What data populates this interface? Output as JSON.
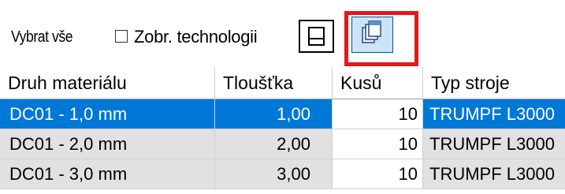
{
  "toolbar": {
    "select_all_label": "Vybrat vše",
    "show_technologies_label": "Zobr. technologii",
    "show_technologies_checked": false,
    "highlight_color": "#e0191c",
    "buttons": [
      {
        "icon": "single-page-icon"
      },
      {
        "icon": "copy-pages-icon",
        "active": true
      }
    ]
  },
  "table": {
    "columns": [
      "Druh materiálu",
      "Tloušťka",
      "Kusů",
      "Typ stroje"
    ],
    "rows": [
      {
        "material": "DC01 - 1,0 mm",
        "thickness": "1,00",
        "pieces": "10",
        "machine": "TRUMPF L3000",
        "selected": true
      },
      {
        "material": "DC01 - 2,0 mm",
        "thickness": "2,00",
        "pieces": "10",
        "machine": "TRUMPF L3000",
        "selected": false
      },
      {
        "material": "DC01 - 3,0 mm",
        "thickness": "3,00",
        "pieces": "10",
        "machine": "TRUMPF L3000",
        "selected": false
      }
    ],
    "selected_color": "#0078d7",
    "row_color": "#e1e1e1"
  }
}
